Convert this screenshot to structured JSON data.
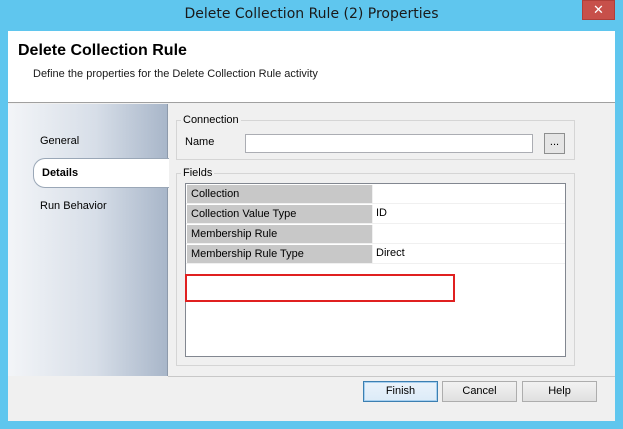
{
  "window": {
    "title": "Delete Collection Rule (2) Properties",
    "close_glyph": "✕"
  },
  "header": {
    "heading": "Delete Collection Rule",
    "subtitle": "Define the properties for the Delete Collection Rule activity"
  },
  "sidebar": {
    "items": [
      {
        "label": "General",
        "active": false
      },
      {
        "label": "Details",
        "active": true
      },
      {
        "label": "Run Behavior",
        "active": false
      }
    ]
  },
  "connection": {
    "group_label": "Connection",
    "name_label": "Name",
    "name_value": "",
    "browse_label": "..."
  },
  "fields": {
    "group_label": "Fields",
    "rows": [
      {
        "key": "Collection",
        "value": ""
      },
      {
        "key": "Collection Value Type",
        "value": "ID"
      },
      {
        "key": "Membership Rule",
        "value": ""
      },
      {
        "key": "Membership Rule Type",
        "value": "Direct"
      }
    ]
  },
  "buttons": {
    "finish": "Finish",
    "cancel": "Cancel",
    "help": "Help"
  },
  "colors": {
    "titlebar": "#5fc6ee",
    "highlight": "#e02020"
  }
}
